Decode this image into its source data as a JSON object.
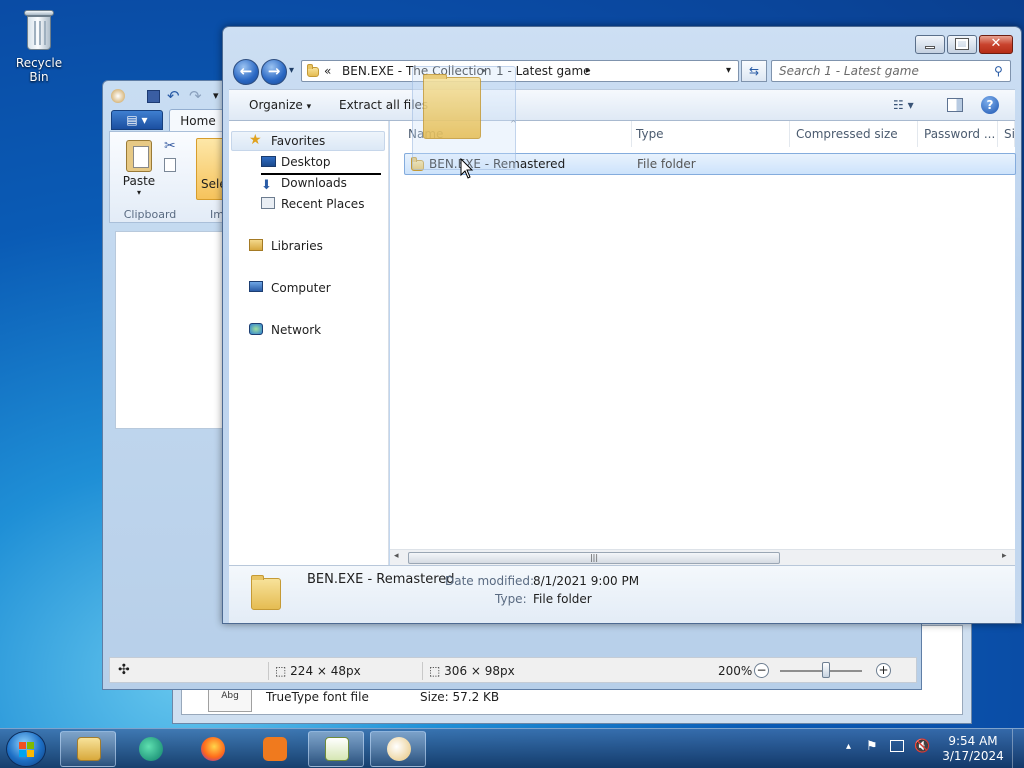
{
  "desktop": {
    "recycle_bin_label": "Recycle Bin"
  },
  "font_window": {
    "file_type": "TrueType font file",
    "size_text": "Size: 57.2 KB",
    "icon_text": "Abg"
  },
  "paint": {
    "tab_home": "Home",
    "paste_label": "Paste",
    "select_label": "Selec",
    "clipboard_group": "Clipboard",
    "image_group_partial": "Im",
    "status": {
      "selection_size": "224 × 48px",
      "image_size": "306 × 98px",
      "zoom": "200%"
    }
  },
  "explorer": {
    "address": {
      "chevron": "«",
      "crumb1": "BEN.EXE - The Collection",
      "crumb2": "1 - Latest game"
    },
    "search_placeholder": "Search 1 - Latest game",
    "commands": {
      "organize": "Organize",
      "extract": "Extract all files"
    },
    "nav": {
      "favorites": "Favorites",
      "desktop": "Desktop",
      "downloads": "Downloads",
      "recent": "Recent Places",
      "libraries": "Libraries",
      "computer": "Computer",
      "network": "Network"
    },
    "columns": {
      "name": "Name",
      "type": "Type",
      "compressed": "Compressed size",
      "password": "Password ...",
      "size_partial": "Si"
    },
    "rows": [
      {
        "name": "BEN.EXE - Remastered",
        "type": "File folder"
      }
    ],
    "details": {
      "name": "BEN.EXE - Remastered",
      "modified_label": "Date modified:",
      "modified_value": "8/1/2021 9:00 PM",
      "type_label": "Type:",
      "type_value": "File folder"
    }
  },
  "taskbar": {
    "time": "9:54 AM",
    "date": "3/17/2024"
  },
  "colors": {
    "accent_blue": "#1d55b0",
    "selection": "#cde3fb",
    "close_red": "#c9432d"
  }
}
